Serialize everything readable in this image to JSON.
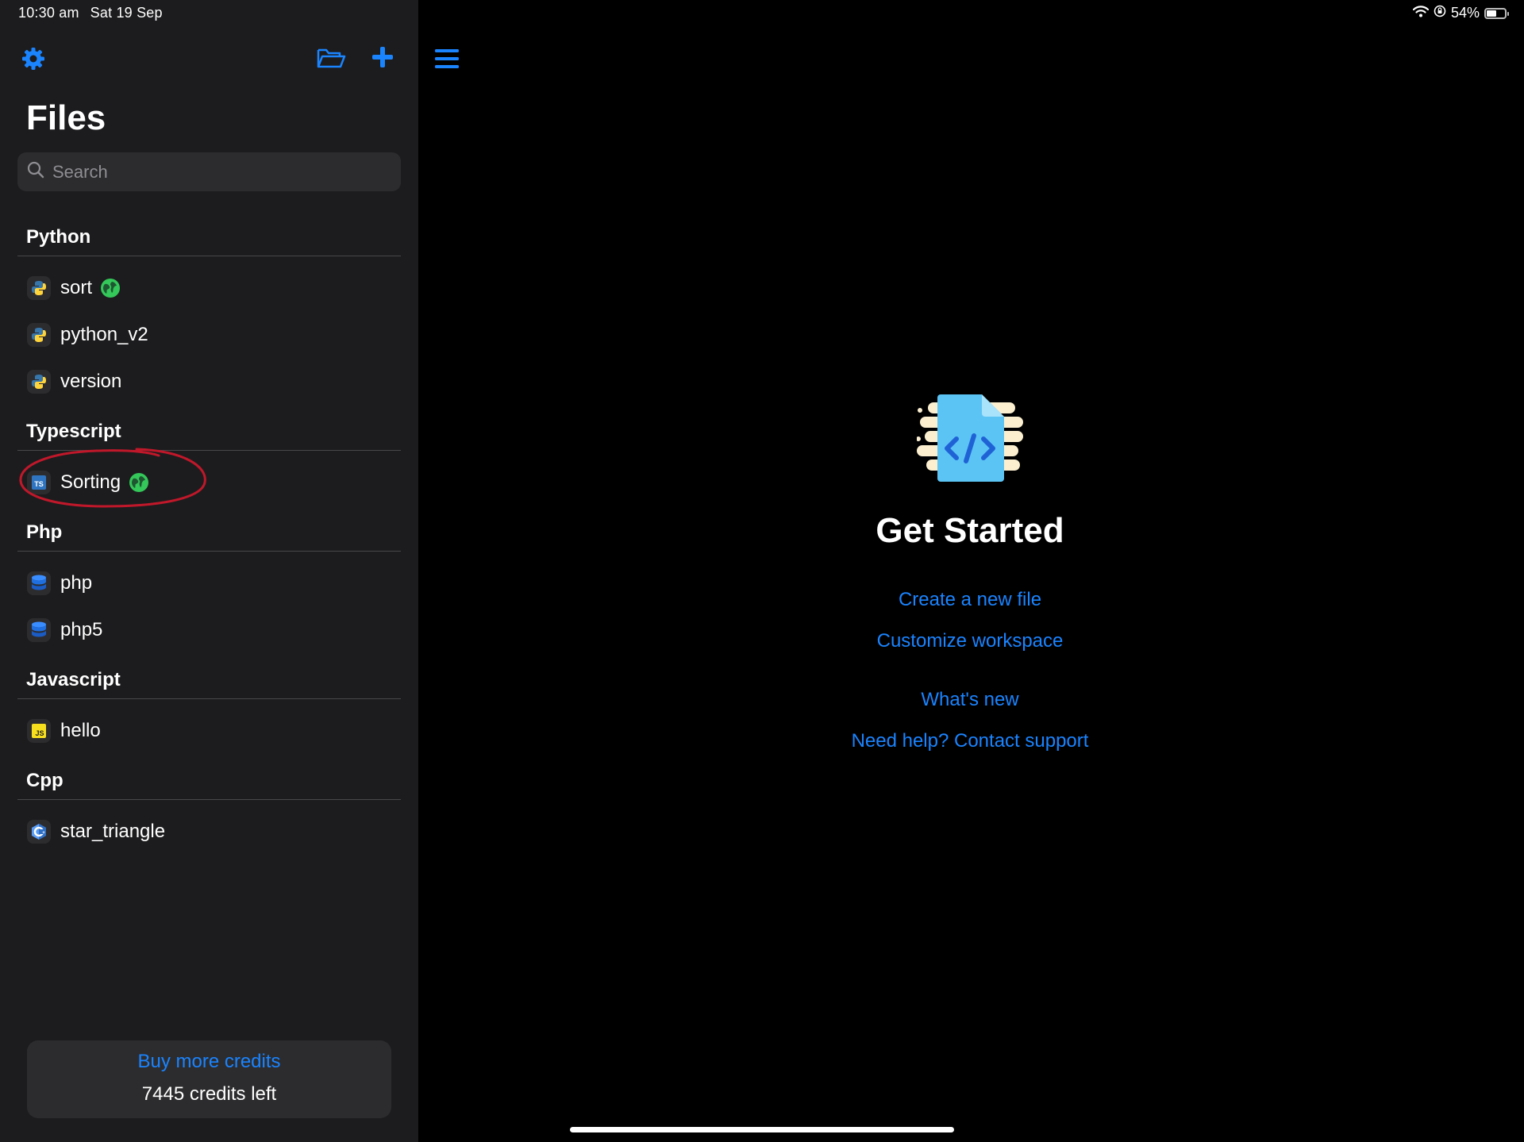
{
  "status_bar": {
    "time": "10:30 am",
    "date": "Sat 19 Sep",
    "battery": "54%",
    "battery_level": 0.54
  },
  "sidebar": {
    "title": "Files",
    "search_placeholder": "Search",
    "sections": [
      {
        "header": "Python",
        "items": [
          {
            "label": "sort",
            "icon": "python-icon",
            "shared": true
          },
          {
            "label": "python_v2",
            "icon": "python-icon",
            "shared": false
          },
          {
            "label": "version",
            "icon": "python-icon",
            "shared": false
          }
        ]
      },
      {
        "header": "Typescript",
        "items": [
          {
            "label": "Sorting",
            "icon": "typescript-icon",
            "shared": true
          }
        ]
      },
      {
        "header": "Php",
        "items": [
          {
            "label": "php",
            "icon": "php-database-icon",
            "shared": false
          },
          {
            "label": "php5",
            "icon": "php-database-icon",
            "shared": false
          }
        ]
      },
      {
        "header": "Javascript",
        "items": [
          {
            "label": "hello",
            "icon": "javascript-icon",
            "shared": false
          }
        ]
      },
      {
        "header": "Cpp",
        "items": [
          {
            "label": "star_triangle",
            "icon": "cpp-icon",
            "shared": false
          }
        ]
      }
    ],
    "credits": {
      "buy_label": "Buy more credits",
      "remaining": "7445 credits left"
    }
  },
  "main": {
    "heading": "Get Started",
    "links": [
      "Create a new file",
      "Customize workspace",
      "What's new",
      "Need help? Contact support"
    ]
  },
  "colors": {
    "accent": "#1a84ff",
    "sidebar_bg": "#1c1c1e",
    "main_bg": "#000000",
    "shared_globe": "#34c759",
    "annotation": "#c0182a"
  }
}
